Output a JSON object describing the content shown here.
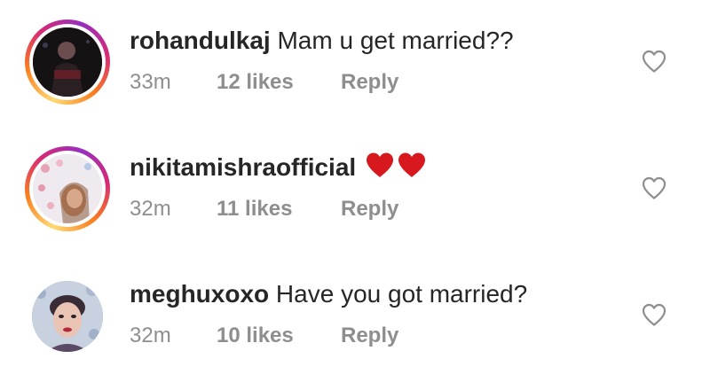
{
  "comments": [
    {
      "username": "rohandulkaj",
      "text": "Mam u get married??",
      "time": "33m",
      "likes": "12 likes",
      "reply": "Reply",
      "story_ring": true
    },
    {
      "username": "nikitamishraofficial",
      "text": "",
      "emoji": [
        "red-heart",
        "red-heart"
      ],
      "time": "32m",
      "likes": "11 likes",
      "reply": "Reply",
      "story_ring": true
    },
    {
      "username": "meghuxoxo",
      "text": "Have you got married?",
      "time": "32m",
      "likes": "10 likes",
      "reply": "Reply",
      "story_ring": false
    }
  ],
  "colors": {
    "text": "#262626",
    "meta": "#8e8e8e",
    "heart_emoji": "#d7191f",
    "story_ring": [
      "#feda75",
      "#fa7e1e",
      "#d62976",
      "#962fbf"
    ]
  }
}
